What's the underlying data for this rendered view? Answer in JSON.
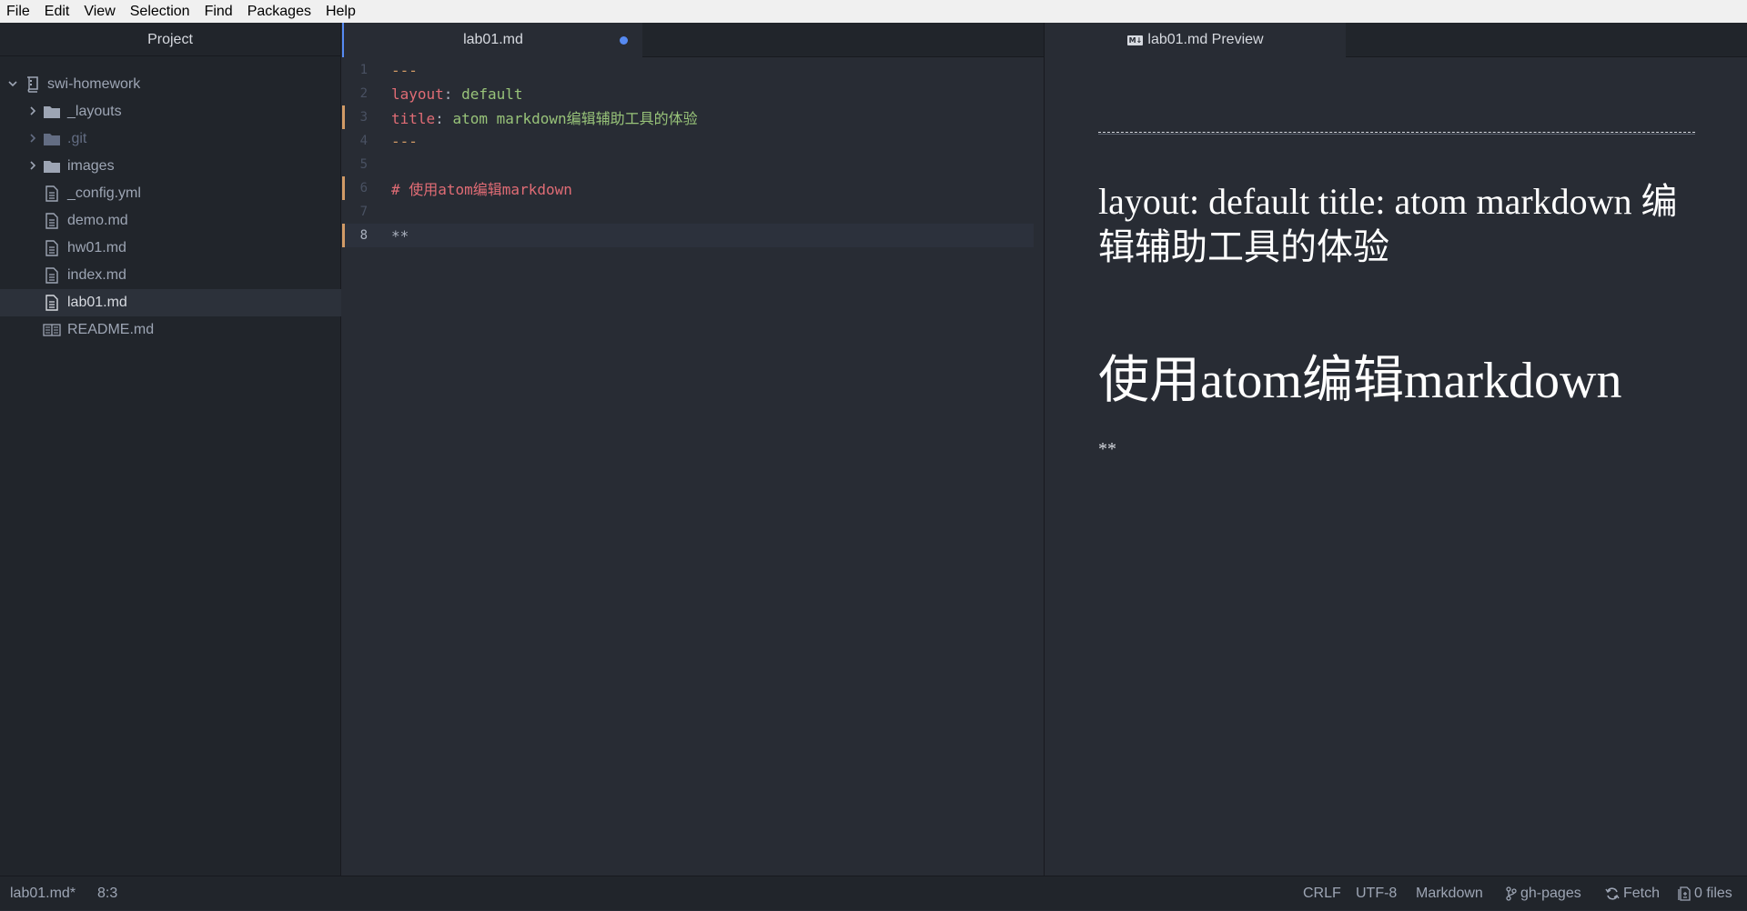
{
  "menu": [
    "File",
    "Edit",
    "View",
    "Selection",
    "Find",
    "Packages",
    "Help"
  ],
  "tree": {
    "title": "Project",
    "root": "swi-homework",
    "items": [
      {
        "label": "_layouts",
        "kind": "folder",
        "collapsed": true
      },
      {
        "label": ".git",
        "kind": "folder",
        "collapsed": true,
        "dim": true
      },
      {
        "label": "images",
        "kind": "folder",
        "collapsed": true
      },
      {
        "label": "_config.yml",
        "kind": "file"
      },
      {
        "label": "demo.md",
        "kind": "file"
      },
      {
        "label": "hw01.md",
        "kind": "file"
      },
      {
        "label": "index.md",
        "kind": "file"
      },
      {
        "label": "lab01.md",
        "kind": "file",
        "selected": true
      },
      {
        "label": "README.md",
        "kind": "readme"
      }
    ]
  },
  "editor": {
    "tab_title": "lab01.md",
    "modified": true,
    "lines": [
      {
        "num": "1",
        "text": "---"
      },
      {
        "num": "2",
        "key": "layout",
        "sep": ": ",
        "value": "default"
      },
      {
        "num": "3",
        "key": "title",
        "sep": ": ",
        "value": "atom markdown编辑辅助工具的体验"
      },
      {
        "num": "4",
        "text": "---"
      },
      {
        "num": "5",
        "text": ""
      },
      {
        "num": "6",
        "text": "# 使用atom编辑markdown"
      },
      {
        "num": "7",
        "text": ""
      },
      {
        "num": "8",
        "text": "**"
      }
    ]
  },
  "preview": {
    "tab_title": "lab01.md Preview",
    "badge": "M↓",
    "paragraph": "layout: default title: atom markdown 编辑辅助工具的体验",
    "heading": "使用atom编辑markdown",
    "paragraph2": "**"
  },
  "status": {
    "file": "lab01.md*",
    "cursor": "8:3",
    "line_ending": "CRLF",
    "encoding": "UTF-8",
    "grammar": "Markdown",
    "branch": "gh-pages",
    "fetch": "Fetch",
    "files": "0 files"
  },
  "colors": {
    "accent": "#568af2",
    "git_modified": "#d19a66",
    "syntax_red": "#e06c75",
    "syntax_green": "#98c379"
  }
}
